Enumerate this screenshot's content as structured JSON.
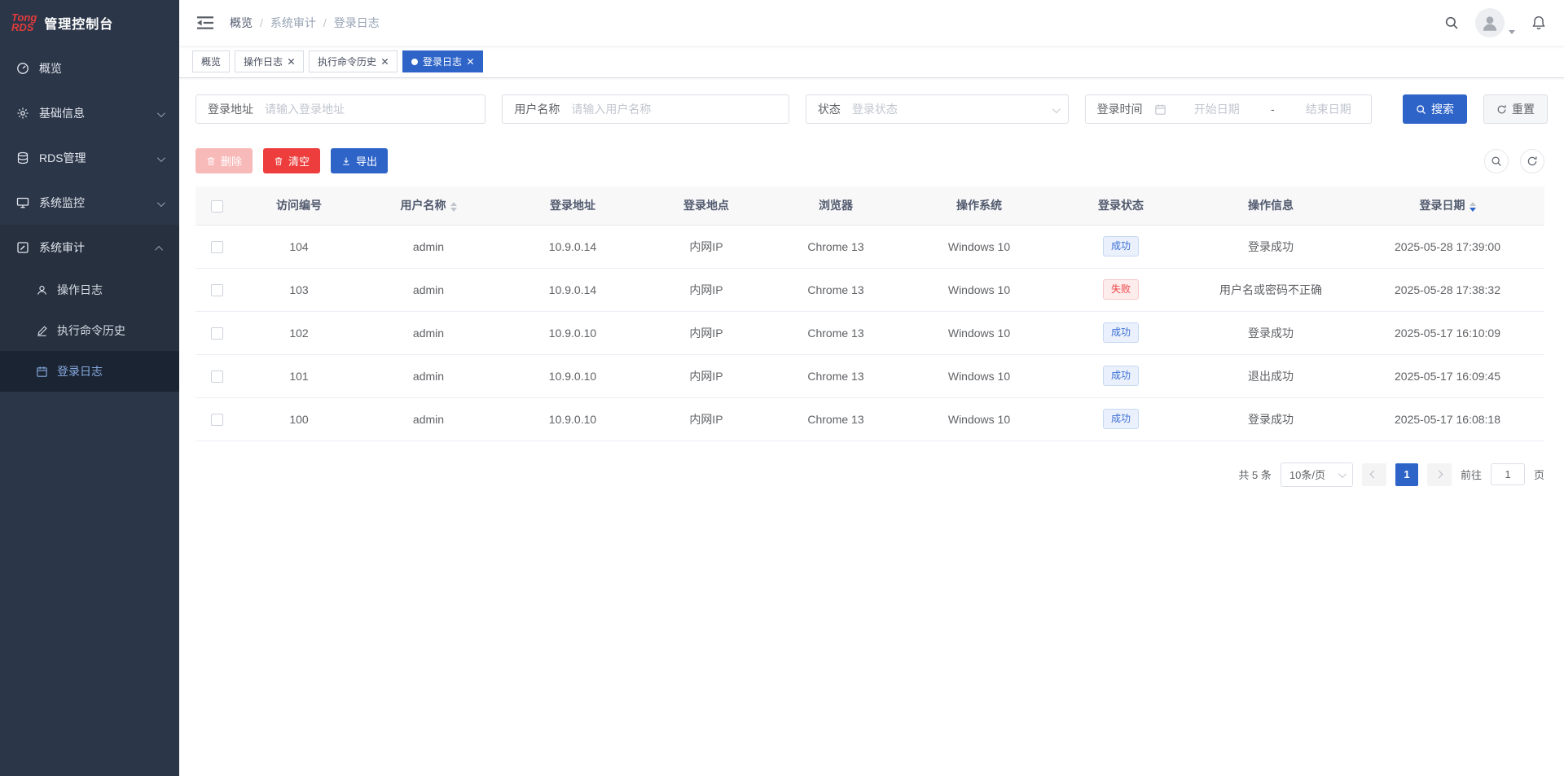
{
  "app": {
    "logo_line1": "Tong",
    "logo_line2": "RDS",
    "logo_title": "管理控制台"
  },
  "sidebar": {
    "items": [
      {
        "label": "概览"
      },
      {
        "label": "基础信息"
      },
      {
        "label": "RDS管理"
      },
      {
        "label": "系统监控"
      },
      {
        "label": "系统审计",
        "children": [
          {
            "label": "操作日志"
          },
          {
            "label": "执行命令历史"
          },
          {
            "label": "登录日志"
          }
        ]
      }
    ]
  },
  "breadcrumb": {
    "separator": "/",
    "items": [
      "概览",
      "系统审计",
      "登录日志"
    ]
  },
  "tabs": [
    {
      "label": "概览"
    },
    {
      "label": "操作日志"
    },
    {
      "label": "执行命令历史"
    },
    {
      "label": "登录日志"
    }
  ],
  "filters": {
    "login_address": {
      "label": "登录地址",
      "placeholder": "请输入登录地址",
      "value": ""
    },
    "user_name": {
      "label": "用户名称",
      "placeholder": "请输入用户名称",
      "value": ""
    },
    "status": {
      "label": "状态",
      "placeholder": "登录状态"
    },
    "login_time": {
      "label": "登录时间",
      "start_placeholder": "开始日期",
      "separator": "-",
      "end_placeholder": "结束日期"
    },
    "search_label": "搜索",
    "reset_label": "重置"
  },
  "toolbar": {
    "delete_label": "删除",
    "clear_label": "清空",
    "export_label": "导出"
  },
  "table": {
    "columns": [
      "访问编号",
      "用户名称",
      "登录地址",
      "登录地点",
      "浏览器",
      "操作系统",
      "登录状态",
      "操作信息",
      "登录日期"
    ],
    "rows": [
      {
        "id": "104",
        "user": "admin",
        "address": "10.9.0.14",
        "location": "内网IP",
        "browser": "Chrome 13",
        "os": "Windows 10",
        "status": "成功",
        "status_type": "success",
        "message": "登录成功",
        "date": "2025-05-28 17:39:00"
      },
      {
        "id": "103",
        "user": "admin",
        "address": "10.9.0.14",
        "location": "内网IP",
        "browser": "Chrome 13",
        "os": "Windows 10",
        "status": "失败",
        "status_type": "fail",
        "message": "用户名或密码不正确",
        "date": "2025-05-28 17:38:32"
      },
      {
        "id": "102",
        "user": "admin",
        "address": "10.9.0.10",
        "location": "内网IP",
        "browser": "Chrome 13",
        "os": "Windows 10",
        "status": "成功",
        "status_type": "success",
        "message": "登录成功",
        "date": "2025-05-17 16:10:09"
      },
      {
        "id": "101",
        "user": "admin",
        "address": "10.9.0.10",
        "location": "内网IP",
        "browser": "Chrome 13",
        "os": "Windows 10",
        "status": "成功",
        "status_type": "success",
        "message": "退出成功",
        "date": "2025-05-17 16:09:45"
      },
      {
        "id": "100",
        "user": "admin",
        "address": "10.9.0.10",
        "location": "内网IP",
        "browser": "Chrome 13",
        "os": "Windows 10",
        "status": "成功",
        "status_type": "success",
        "message": "登录成功",
        "date": "2025-05-17 16:08:18"
      }
    ]
  },
  "pagination": {
    "total_text": "共 5 条",
    "page_size": "10条/页",
    "current_page": "1",
    "goto_label": "前往",
    "goto_value": "1",
    "page_suffix": "页"
  },
  "colors": {
    "primary": "#2e64c8",
    "danger": "#ee3d3d",
    "danger_disabled": "#f8b9b9",
    "sidebar_bg": "#2b3648",
    "sidebar_active_bg": "#1b2433",
    "success_badge_text": "#3c6fd6",
    "fail_badge_text": "#ef4444",
    "logo_red": "#e23c3c"
  }
}
